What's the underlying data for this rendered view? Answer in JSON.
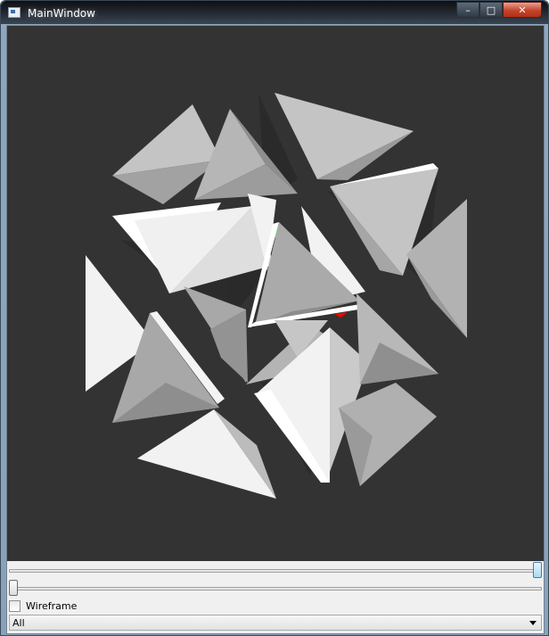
{
  "window": {
    "title": "MainWindow",
    "minimize_glyph": "–",
    "maximize_glyph": "□",
    "close_glyph": "✕"
  },
  "controls": {
    "slider_top": {
      "value_fraction": 1.0
    },
    "slider_bottom": {
      "value_fraction": 0.0
    },
    "wireframe_label": "Wireframe",
    "wireframe_checked": false,
    "mode_select_value": "All"
  },
  "colors": {
    "viewport_background": "#333333",
    "axis_y": "#00ff00",
    "axis_x": "#ff0000"
  }
}
